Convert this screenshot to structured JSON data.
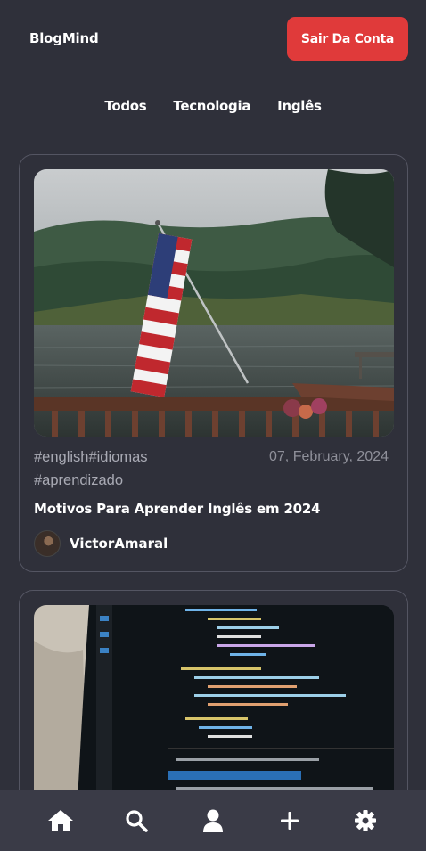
{
  "header": {
    "brand": "BlogMind",
    "logout_label": "Sair Da Conta"
  },
  "tabs": [
    {
      "label": "Todos"
    },
    {
      "label": "Tecnologia"
    },
    {
      "label": "Inglês"
    }
  ],
  "posts": [
    {
      "tags": "#english#idiomas #aprendizado",
      "date": "07, February, 2024",
      "title": "Motivos Para Aprender Inglês em 2024",
      "author": "VictorAmaral",
      "image": "american-flag-lake-photo"
    },
    {
      "image": "code-editor-laptop-photo"
    }
  ],
  "bottom_nav": [
    {
      "icon": "home-icon"
    },
    {
      "icon": "search-icon"
    },
    {
      "icon": "user-icon"
    },
    {
      "icon": "plus-icon"
    },
    {
      "icon": "gear-icon"
    }
  ],
  "colors": {
    "background": "#2f303a",
    "logout_button": "#e03a3a",
    "nav_bar": "#3a3b47",
    "card_border": "#545562",
    "muted_text": "#a9aab4"
  }
}
